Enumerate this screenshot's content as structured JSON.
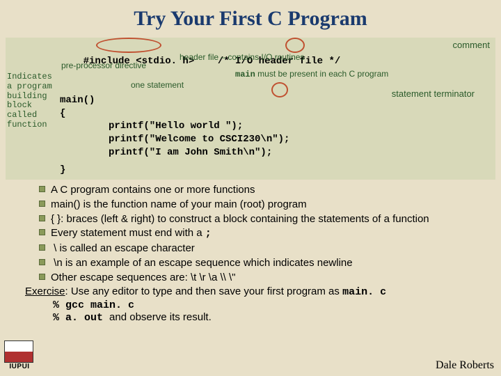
{
  "title": "Try Your First C Program",
  "code": {
    "l1a": "#include <stdio. h>",
    "l1b": "/* I/O header file */",
    "l2": "main()",
    "l3": "{",
    "l4": "printf(\"Hello world \");",
    "l5": "printf(\"Welcome to CSCI230\\n\");",
    "l6": "printf(\"I am John Smith\\n\");",
    "l7": "}"
  },
  "annot": {
    "comment": "comment",
    "header_note": "header file – contains I/O routines",
    "preproc": "pre-processor directive",
    "main_note_b": "main",
    "main_note_rest": " must be present in each C program",
    "one_stmt": "one statement",
    "side_label": "Indicates a program building block called function",
    "stmt_term": "statement terminator"
  },
  "bullets": [
    "A  C program contains one or more functions",
    "main() is the function name of your main (root) program",
    "{  }: braces (left & right) to construct a block containing the statements of a function",
    "Every statement must end with a ;",
    " \\ is called an escape character",
    " \\n  is an example of an escape sequence which indicates newline",
    "Other escape sequences are:  \\t  \\r  \\a  \\\\  \\\""
  ],
  "exercise": {
    "label": "Exercise",
    "text": ": Use any editor to type and then save your first program as  ",
    "file": "main. c"
  },
  "cmds": {
    "c1": "% gcc main. c",
    "c2": "% a. out",
    "observe": "and observe its result."
  },
  "footer": {
    "iupui": "IUPUI",
    "author": "Dale Roberts"
  }
}
